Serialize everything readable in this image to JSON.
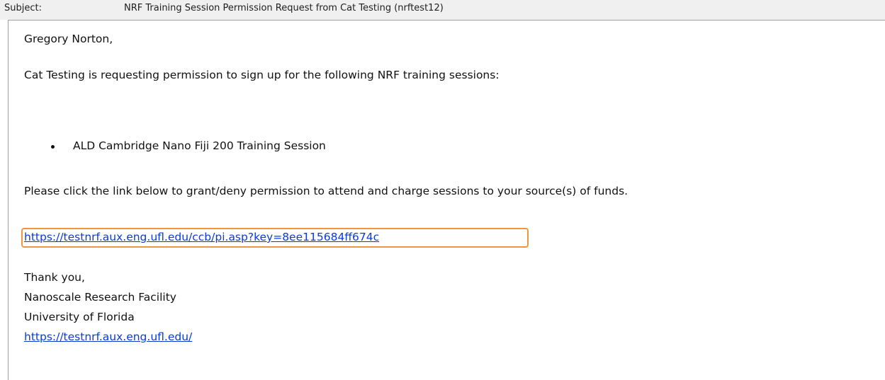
{
  "header": {
    "subject_label": "Subject:",
    "subject_value": "NRF Training Session Permission Request from Cat Testing (nrftest12)"
  },
  "message": {
    "greeting": "Gregory Norton,",
    "intro": "Cat Testing is requesting permission to sign up for the following NRF training sessions:",
    "sessions": [
      "ALD Cambridge Nano Fiji 200 Training Session"
    ],
    "instruction": "Please click the link below to grant/deny permission to attend and charge sessions to your source(s) of funds.",
    "permission_link": "https://testnrf.aux.eng.ufl.edu/ccb/pi.asp?key=8ee115684ff674c",
    "signature": {
      "thanks": "Thank you,",
      "organization": "Nanoscale Research Facility",
      "university": "University of Florida",
      "website": "https://testnrf.aux.eng.ufl.edu/"
    }
  },
  "colors": {
    "link": "#0a3cd6",
    "highlight_box": "#f0953f",
    "header_bg": "#f0f0f0"
  }
}
